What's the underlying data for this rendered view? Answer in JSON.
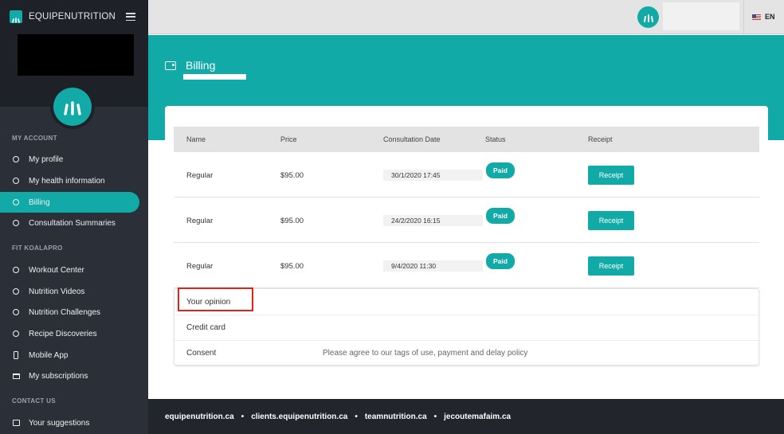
{
  "brand": {
    "name": "EQUIPENUTRITION"
  },
  "sidebar": {
    "sections": [
      {
        "title": "MY ACCOUNT"
      },
      {
        "title": "FIT KOALAPRO"
      },
      {
        "title": "CONTACT US"
      }
    ],
    "items": [
      {
        "label": "My profile",
        "icon": "circle-icon"
      },
      {
        "label": "My health information",
        "icon": "circle-icon"
      },
      {
        "label": "Billing",
        "icon": "circle-icon",
        "active": true
      },
      {
        "label": "Consultation Summaries",
        "icon": "circle-icon"
      },
      {
        "label": "Workout Center",
        "icon": "circle-icon"
      },
      {
        "label": "Nutrition Videos",
        "icon": "circle-icon"
      },
      {
        "label": "Nutrition Challenges",
        "icon": "circle-icon"
      },
      {
        "label": "Recipe Discoveries",
        "icon": "circle-icon"
      },
      {
        "label": "Mobile App",
        "icon": "phone-icon"
      },
      {
        "label": "My subscriptions",
        "icon": "card-icon"
      },
      {
        "label": "Your suggestions",
        "icon": "speech-icon"
      }
    ]
  },
  "topbar": {
    "language": "EN"
  },
  "page": {
    "title": "Billing"
  },
  "table": {
    "headers": {
      "name": "Name",
      "price": "Price",
      "date": "Consultation Date",
      "status": "Status",
      "receipt": "Receipt"
    },
    "rows": [
      {
        "name": "Regular",
        "price": "$95.00",
        "date": "30/1/2020 17:45",
        "status": "Paid",
        "receipt": "Receipt"
      },
      {
        "name": "Regular",
        "price": "$95.00",
        "date": "24/2/2020 16:15",
        "status": "Paid",
        "receipt": "Receipt"
      },
      {
        "name": "Regular",
        "price": "$95.00",
        "date": "9/4/2020 11:30",
        "status": "Paid",
        "receipt": "Receipt"
      }
    ]
  },
  "options": {
    "opinion": "Your opinion",
    "credit_card": "Credit card",
    "consent": "Consent",
    "consent_text": "Please agree to our tags of use, payment and delay policy"
  },
  "footer": {
    "links": [
      "equipenutrition.ca",
      "clients.equipenutrition.ca",
      "teamnutrition.ca",
      "jecoutemafaim.ca"
    ],
    "separator": "•"
  },
  "colors": {
    "accent": "#11aaa6",
    "sidebar": "#2b2f38",
    "footer": "#22252c",
    "highlight": "#e2231a"
  }
}
